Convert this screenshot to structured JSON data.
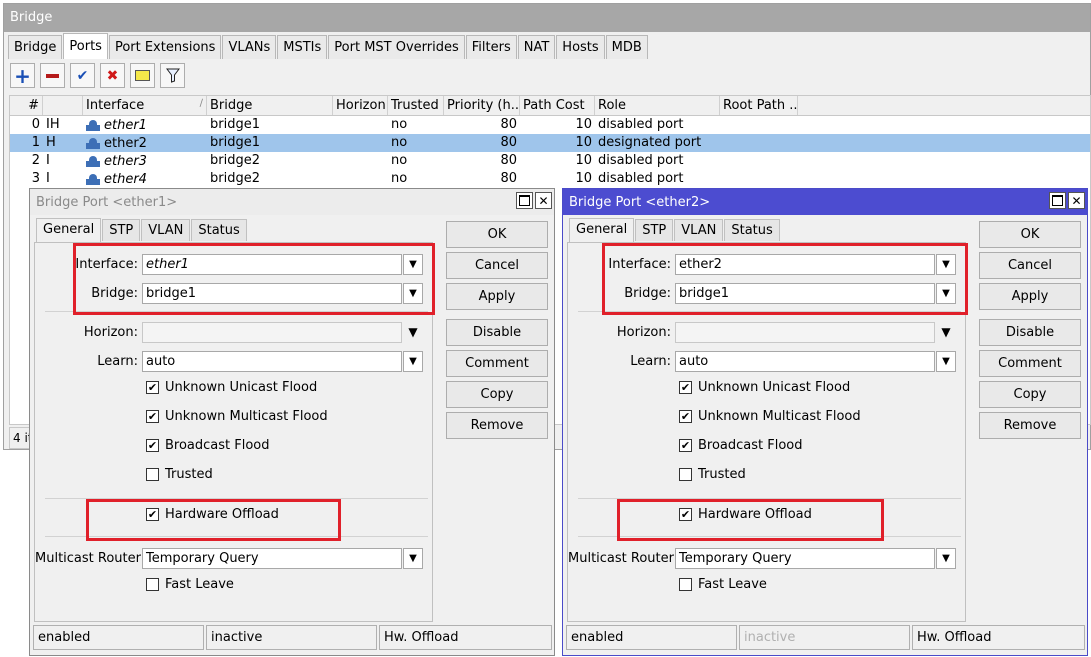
{
  "main": {
    "title": "Bridge",
    "tabs": [
      "Bridge",
      "Ports",
      "Port Extensions",
      "VLANs",
      "MSTIs",
      "Port MST Overrides",
      "Filters",
      "NAT",
      "Hosts",
      "MDB"
    ],
    "active_tab": "Ports",
    "toolbar": {
      "add": "+",
      "remove": "−",
      "enable": "✔",
      "disable": "✖",
      "comment": "▭",
      "filter": "⚲"
    },
    "columns": [
      "#",
      "",
      "Interface",
      "Bridge",
      "Horizon",
      "Trusted",
      "Priority (h...",
      "Path Cost",
      "Role",
      "Root Path ..."
    ],
    "rows": [
      {
        "num": "0",
        "flags": "IH",
        "interface": "ether1",
        "bridge": "bridge1",
        "horizon": "",
        "trusted": "no",
        "priority": "80",
        "path_cost": "10",
        "role": "disabled port",
        "root_path": ""
      },
      {
        "num": "1",
        "flags": "H",
        "interface": "ether2",
        "bridge": "bridge1",
        "horizon": "",
        "trusted": "no",
        "priority": "80",
        "path_cost": "10",
        "role": "designated port",
        "root_path": ""
      },
      {
        "num": "2",
        "flags": "I",
        "interface": "ether3",
        "bridge": "bridge2",
        "horizon": "",
        "trusted": "no",
        "priority": "80",
        "path_cost": "10",
        "role": "disabled port",
        "root_path": ""
      },
      {
        "num": "3",
        "flags": "I",
        "interface": "ether4",
        "bridge": "bridge2",
        "horizon": "",
        "trusted": "no",
        "priority": "80",
        "path_cost": "10",
        "role": "disabled port",
        "root_path": ""
      }
    ],
    "item_count": "4 items"
  },
  "dialogs": [
    {
      "title": "Bridge Port <ether1>",
      "tabs": [
        "General",
        "STP",
        "VLAN",
        "Status"
      ],
      "labels": {
        "interface": "Interface:",
        "bridge": "Bridge:",
        "horizon": "Horizon:",
        "learn": "Learn:",
        "multicast_router": "Multicast Router:"
      },
      "values": {
        "interface": "ether1",
        "bridge": "bridge1",
        "horizon": "",
        "learn": "auto",
        "multicast_router": "Temporary Query"
      },
      "checks": {
        "unknown_unicast_flood": {
          "label": "Unknown Unicast Flood",
          "checked": "✔"
        },
        "unknown_multicast_flood": {
          "label": "Unknown Multicast Flood",
          "checked": "✔"
        },
        "broadcast_flood": {
          "label": "Broadcast Flood",
          "checked": "✔"
        },
        "trusted": {
          "label": "Trusted",
          "checked": ""
        },
        "hardware_offload": {
          "label": "Hardware Offload",
          "checked": "✔"
        },
        "fast_leave": {
          "label": "Fast Leave",
          "checked": ""
        }
      },
      "buttons": {
        "ok": "OK",
        "cancel": "Cancel",
        "apply": "Apply",
        "disable": "Disable",
        "comment": "Comment",
        "copy": "Copy",
        "remove": "Remove"
      },
      "status": [
        "enabled",
        "inactive",
        "Hw. Offload"
      ]
    },
    {
      "title": "Bridge Port <ether2>",
      "tabs": [
        "General",
        "STP",
        "VLAN",
        "Status"
      ],
      "labels": {
        "interface": "Interface:",
        "bridge": "Bridge:",
        "horizon": "Horizon:",
        "learn": "Learn:",
        "multicast_router": "Multicast Router:"
      },
      "values": {
        "interface": "ether2",
        "bridge": "bridge1",
        "horizon": "",
        "learn": "auto",
        "multicast_router": "Temporary Query"
      },
      "checks": {
        "unknown_unicast_flood": {
          "label": "Unknown Unicast Flood",
          "checked": "✔"
        },
        "unknown_multicast_flood": {
          "label": "Unknown Multicast Flood",
          "checked": "✔"
        },
        "broadcast_flood": {
          "label": "Broadcast Flood",
          "checked": "✔"
        },
        "trusted": {
          "label": "Trusted",
          "checked": ""
        },
        "hardware_offload": {
          "label": "Hardware Offload",
          "checked": "✔"
        },
        "fast_leave": {
          "label": "Fast Leave",
          "checked": ""
        }
      },
      "buttons": {
        "ok": "OK",
        "cancel": "Cancel",
        "apply": "Apply",
        "disable": "Disable",
        "comment": "Comment",
        "copy": "Copy",
        "remove": "Remove"
      },
      "status": [
        "enabled",
        "inactive",
        "Hw. Offload"
      ]
    }
  ],
  "colors": {
    "highlight_box": "#e0202a",
    "selected_row": "#9fc5eb",
    "active_dialog_title": "#4c4cd0"
  }
}
